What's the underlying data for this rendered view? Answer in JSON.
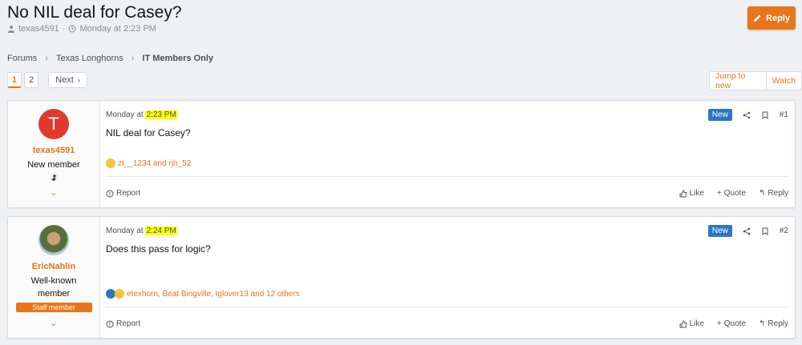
{
  "thread": {
    "title": "No NIL deal for Casey?",
    "author": "texas4591",
    "date": "Monday at 2:23 PM",
    "reply_label": "Reply"
  },
  "breadcrumb": [
    "Forums",
    "Texas Longhorns",
    "IT Members Only"
  ],
  "pager": {
    "pages": [
      "1",
      "2"
    ],
    "current": "1",
    "next_label": "Next"
  },
  "jump_label": "Jump to new",
  "watch_label": "Watch",
  "post_actions": {
    "new_badge": "New",
    "report": "Report",
    "like": "Like",
    "quote": "Quote",
    "reply": "Reply"
  },
  "posts": [
    {
      "username": "texas4591",
      "user_title": "New member",
      "avatar_letter": "T",
      "avatar_color": "#e03a2f",
      "date_prefix": "Monday at",
      "time": "2:23 PM",
      "number": "#1",
      "body": "NIL deal for Casey?",
      "reactions": "zt__1234 and rjh_52"
    },
    {
      "username": "EricNahlin",
      "user_title": "Well-known member",
      "staff_badge": "Staff member",
      "date_prefix": "Monday at",
      "time": "2:24 PM",
      "number": "#2",
      "body": "Does this pass for logic?",
      "reactions": "etexhorn, Beat Bingville, tglover13 and 12 others"
    }
  ],
  "colors": {
    "accent": "#e8751a",
    "new_badge": "#2b77c4",
    "highlight": "#ffff00"
  }
}
